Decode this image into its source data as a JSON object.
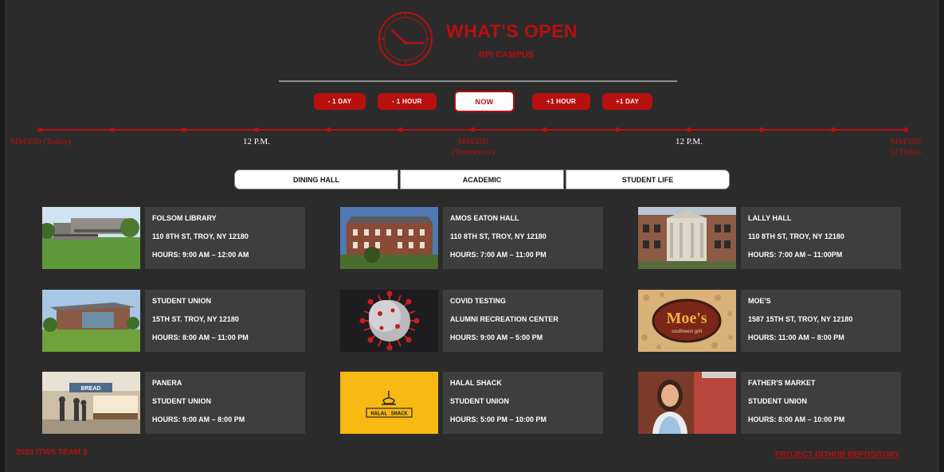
{
  "header": {
    "title": "WHAT'S OPEN",
    "subtitle": "RPI CAMPUS",
    "logo_icon": "clock-icon"
  },
  "time_controls": {
    "minus_day": "- 1 DAY",
    "minus_hour": "- 1 HOUR",
    "now": "NOW",
    "plus_hour": "+1 HOUR",
    "plus_day": "+1 DAY"
  },
  "timeline": {
    "labels": [
      "MM/DD (Today)",
      "12 P.M.",
      "MM/DD",
      "(Tomorrow)",
      "12 P.M.",
      "MM/DD",
      "(2 Days)"
    ]
  },
  "categories": [
    "DINING HALL",
    "ACADEMIC",
    "STUDENT LIFE"
  ],
  "locations": [
    {
      "name": "FOLSOM LIBRARY",
      "address": "110 8TH ST, TROY, NY 12180",
      "hours": "HOURS: 9:00 AM – 12:00 AM",
      "image": "folsom-library-photo"
    },
    {
      "name": "AMOS EATON HALL",
      "address": "110 8TH ST, TROY, NY 12180",
      "hours": "HOURS: 7:00 AM – 11:00 PM",
      "image": "amos-eaton-hall-photo"
    },
    {
      "name": "LALLY HALL",
      "address": "110 8TH ST, TROY, NY 12180",
      "hours": "HOURS: 7:00 AM – 11:00PM",
      "image": "lally-hall-photo"
    },
    {
      "name": "STUDENT UNION",
      "address": "15TH ST. TROY, NY 12180",
      "hours": "HOURS: 8:00 AM – 11:00 PM",
      "image": "student-union-photo"
    },
    {
      "name": "COVID TESTING",
      "address": "ALUMNI RECREATION CENTER",
      "hours": "HOURS: 9:00 AM – 5:00 PM",
      "image": "covid-virus-image"
    },
    {
      "name": "MOE'S",
      "address": "1587 15TH ST, TROY, NY 12180",
      "hours": "HOURS: 11:00 AM – 8:00 PM",
      "image": "moes-logo-image"
    },
    {
      "name": "PANERA",
      "address": "STUDENT UNION",
      "hours": "HOURS: 9:00 AM – 8:00 PM",
      "image": "panera-photo"
    },
    {
      "name": "HALAL SHACK",
      "address": "STUDENT UNION",
      "hours": "HOURS: 5:00 PM – 10:00 PM",
      "image": "halal-shack-logo"
    },
    {
      "name": "FATHER'S MARKET",
      "address": "STUDENT UNION",
      "hours": "HOURS: 8:00 AM – 10:00 PM",
      "image": "fathers-market-photo"
    }
  ],
  "logo_text": {
    "moes": "Moe's",
    "moes_sub": "southwest grill",
    "halal": "HALAL SHACK"
  },
  "footer": {
    "team": "2020 ITWS TEAM 3",
    "repo_link": "PROJECT GITHUB REPOSITORY"
  },
  "colors": {
    "accent": "#b80f0f",
    "background": "#2b2b2b",
    "card": "#3e3e3e"
  }
}
